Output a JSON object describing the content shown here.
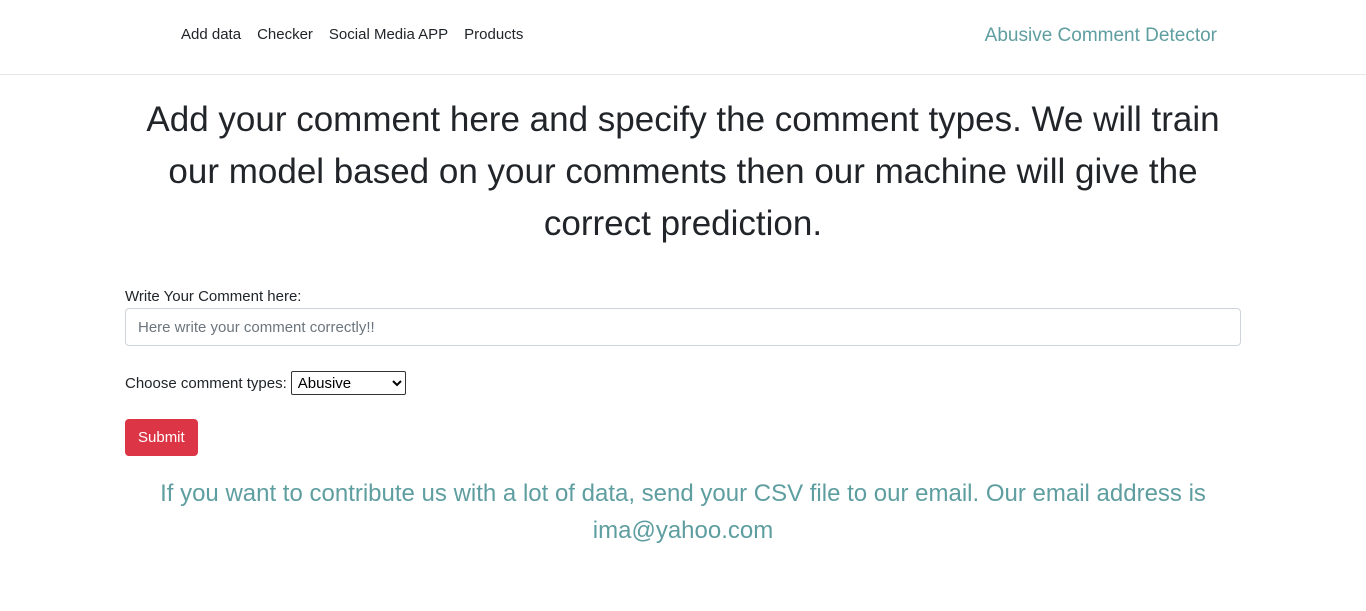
{
  "navbar": {
    "links": [
      "Add data",
      "Checker",
      "Social Media APP",
      "Products"
    ],
    "brand": "Abusive Comment Detector"
  },
  "main": {
    "heading": "Add your comment here and specify the comment types. We will train our model based on your comments then our machine will give the correct prediction.",
    "form": {
      "comment_label": "Write Your Comment here:",
      "comment_placeholder": "Here write your comment correctly!!",
      "comment_value": "",
      "type_label": "Choose comment types:",
      "type_selected": "Abusive",
      "submit_label": "Submit"
    },
    "contribute_text": "If you want to contribute us with a lot of data, send your CSV file to our email. Our email address is ima@yahoo.com"
  },
  "colors": {
    "brand": "#5f9ea0",
    "submit": "#dc3545"
  }
}
